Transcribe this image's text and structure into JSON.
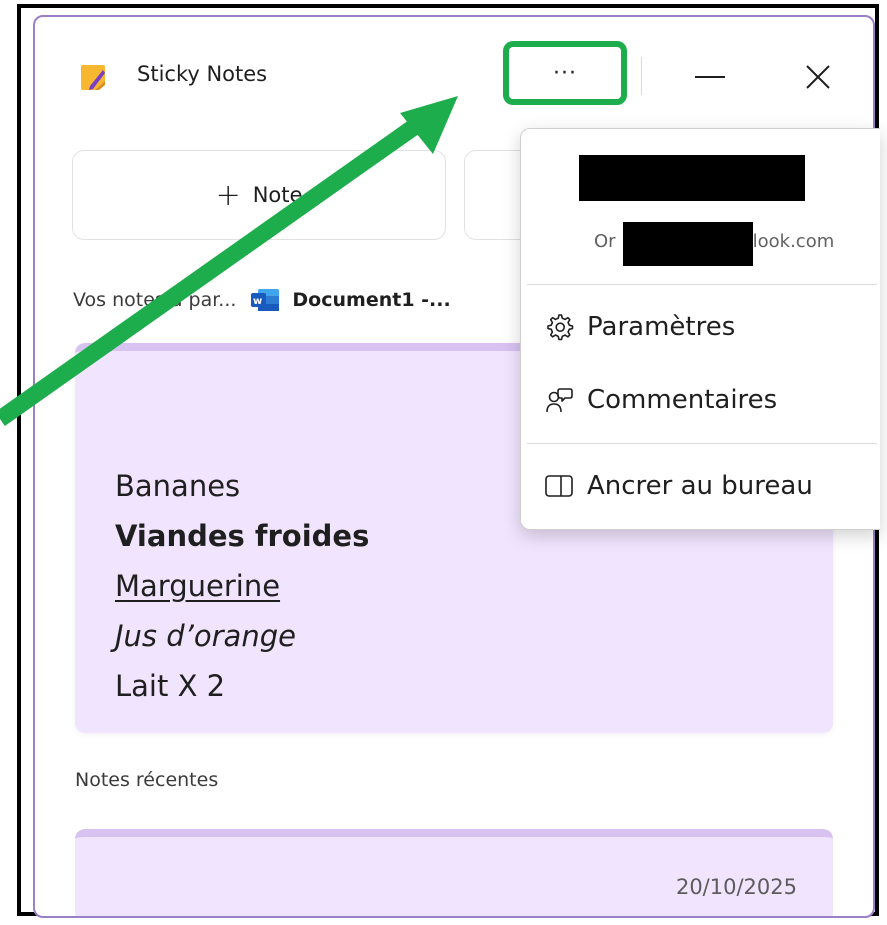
{
  "window": {
    "title": "Sticky Notes",
    "more_label": "···"
  },
  "actions": {
    "new_note_label": "Note"
  },
  "notes_from": {
    "prefix": "Vos notes à par...",
    "document_name": "Document1 -..."
  },
  "note": {
    "lines": [
      "Bananes",
      "Viandes froides",
      "Marguerine",
      "Jus d’orange",
      "Lait X 2"
    ]
  },
  "recent": {
    "label": "Notes récentes",
    "date": "20/10/2025"
  },
  "menu": {
    "email_prefix": "Or",
    "email_suffix": "tlook.com",
    "items": [
      {
        "label": "Paramètres",
        "icon": "gear-icon"
      },
      {
        "label": "Commentaires",
        "icon": "feedback-icon"
      },
      {
        "label": "Ancrer au bureau",
        "icon": "dock-icon"
      }
    ]
  },
  "colors": {
    "highlight_green": "#1ead4c",
    "note_purple": "#f0e4fe",
    "note_border": "#d8c2f2",
    "window_border": "#9b7fc9"
  }
}
